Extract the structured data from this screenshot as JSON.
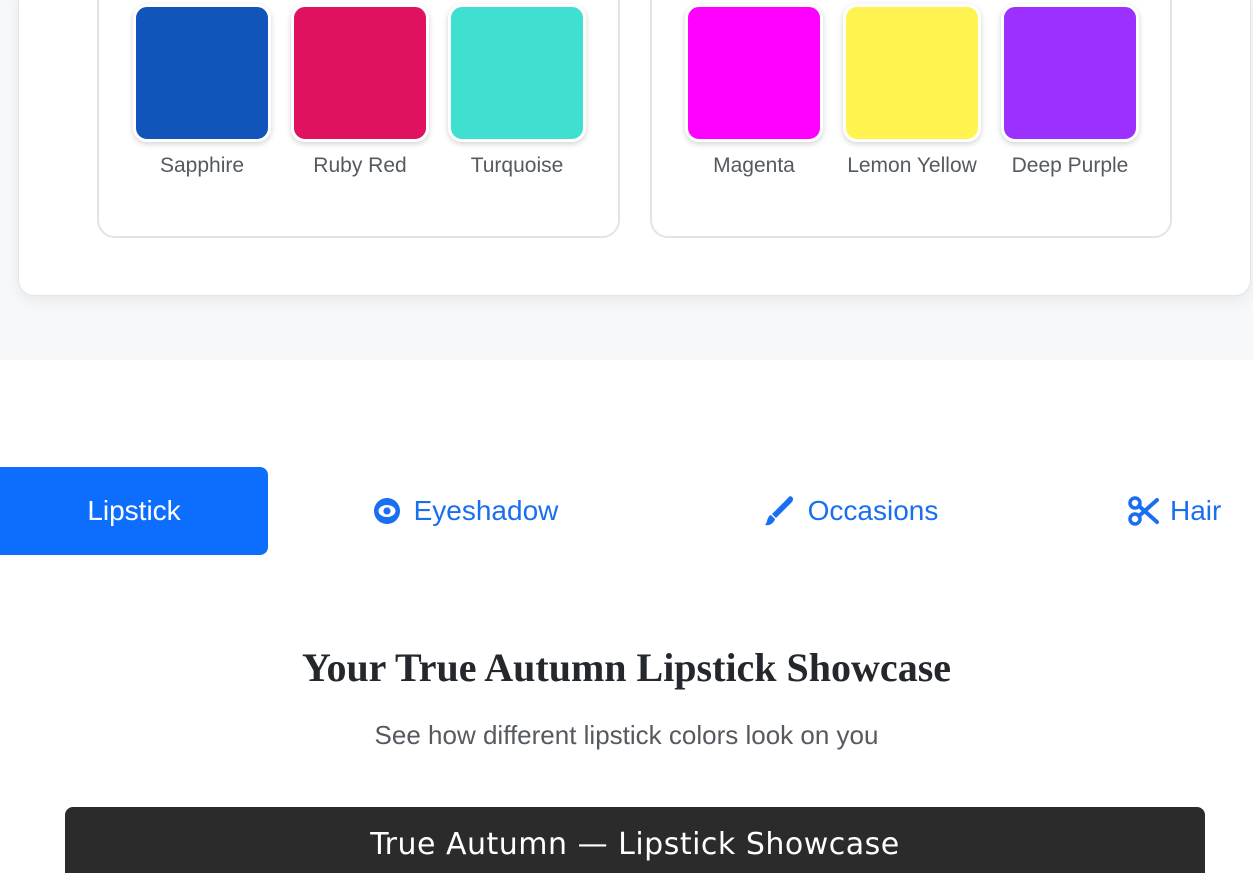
{
  "palette": {
    "left_group": {
      "heading": "",
      "swatches": [
        {
          "name": "Sapphire",
          "color": "#1155bb"
        },
        {
          "name": "Ruby Red",
          "color": "#e0115f"
        },
        {
          "name": "Turquoise",
          "color": "#40e0d0"
        }
      ]
    },
    "right_group": {
      "heading": "",
      "swatches": [
        {
          "name": "Magenta",
          "color": "#ff00ff"
        },
        {
          "name": "Lemon Yellow",
          "color": "#fff44f"
        },
        {
          "name": "Deep Purple",
          "color": "#9b30ff"
        }
      ]
    }
  },
  "tabs": [
    {
      "label": "Lipstick",
      "icon": "",
      "active": true
    },
    {
      "label": "Eyeshadow",
      "icon": "eye-icon",
      "active": false
    },
    {
      "label": "Occasions",
      "icon": "brush-icon",
      "active": false
    },
    {
      "label": "Hair",
      "icon": "scissors-icon",
      "active": false
    }
  ],
  "showcase": {
    "title": "Your True Autumn Lipstick Showcase",
    "subtitle": "See how different lipstick colors look on you",
    "panel_title": "True Autumn — Lipstick Showcase"
  },
  "colors": {
    "accent": "#0d6efd",
    "tab_text": "#1a6ef0",
    "panel_bg": "#2b2b2b"
  }
}
